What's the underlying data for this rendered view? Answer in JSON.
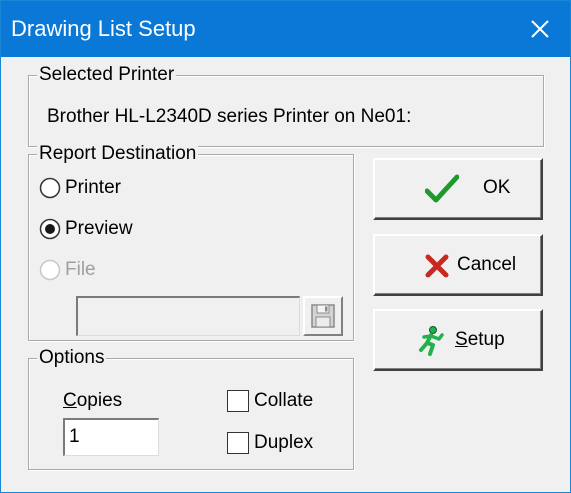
{
  "window": {
    "title": "Drawing List Setup"
  },
  "selected_printer": {
    "legend": "Selected Printer",
    "value": "Brother HL-L2340D series Printer on Ne01:"
  },
  "report_destination": {
    "legend": "Report Destination",
    "options": [
      {
        "label": "Printer",
        "selected": false,
        "enabled": true
      },
      {
        "label": "Preview",
        "selected": true,
        "enabled": true
      },
      {
        "label": "File",
        "selected": false,
        "enabled": false
      }
    ],
    "file_path": ""
  },
  "options": {
    "legend": "Options",
    "copies_label": "Copies",
    "copies_value": "1",
    "collate_label": "Collate",
    "collate_checked": false,
    "duplex_label": "Duplex",
    "duplex_checked": false
  },
  "buttons": {
    "ok": "OK",
    "cancel": "Cancel",
    "setup": "Setup"
  },
  "colors": {
    "titlebar": "#0a78d7",
    "ok_check": "#1e9a2a",
    "cancel_x": "#c8281e",
    "setup_figure": "#22b14c"
  },
  "icons": {
    "close": "close-icon",
    "ok": "green-check-icon",
    "cancel": "red-x-icon",
    "setup": "running-man-icon",
    "browse": "floppy-disk-icon"
  }
}
